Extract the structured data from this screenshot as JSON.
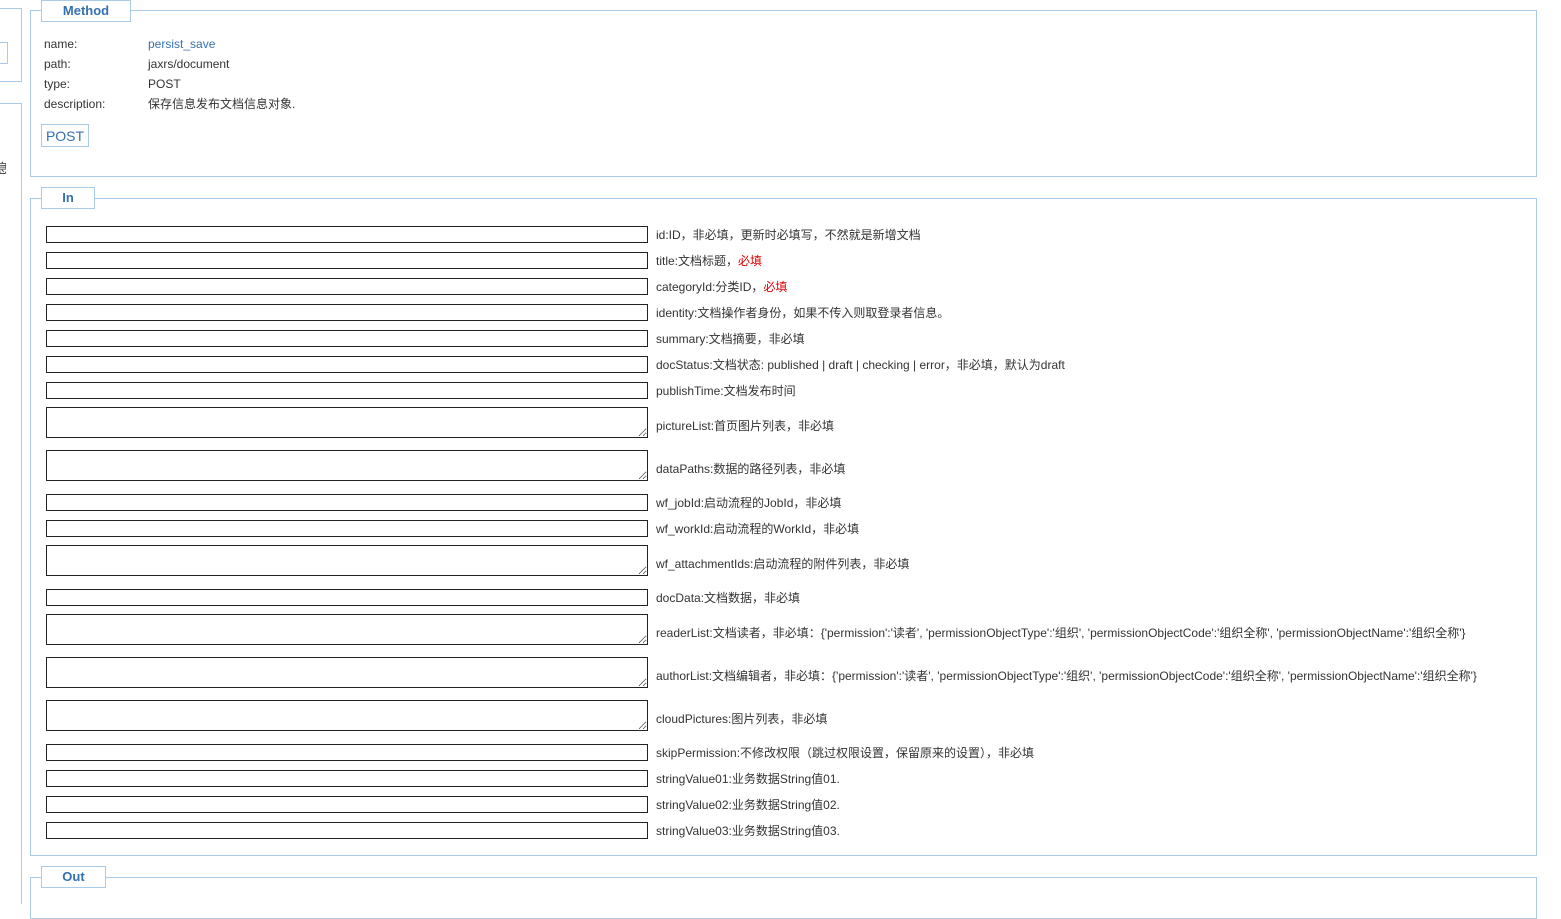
{
  "method": {
    "legend": "Method",
    "rows": [
      {
        "key": "name:",
        "value": "persist_save"
      },
      {
        "key": "path:",
        "value": "jaxrs/document"
      },
      {
        "key": "type:",
        "value": "POST"
      },
      {
        "key": "description:",
        "value": "保存信息发布文档信息对象."
      }
    ],
    "post_button": "POST"
  },
  "in": {
    "legend": "In",
    "params": [
      {
        "label": "id:ID，非必填，更新时必填写，不然就是新增文档"
      },
      {
        "label": "title:文档标题，",
        "required": "必填"
      },
      {
        "label": "categoryId:分类ID，",
        "required": "必填"
      },
      {
        "label": "identity:文档操作者身份，如果不传入则取登录者信息。"
      },
      {
        "label": "summary:文档摘要，非必填"
      },
      {
        "label": "docStatus:文档状态: published | draft | checking | error，非必填，默认为draft"
      },
      {
        "label": "publishTime:文档发布时间"
      },
      {
        "label": "pictureList:首页图片列表，非必填"
      },
      {
        "label": "dataPaths:数据的路径列表，非必填"
      },
      {
        "label": "wf_jobId:启动流程的JobId，非必填"
      },
      {
        "label": "wf_workId:启动流程的WorkId，非必填"
      },
      {
        "label": "wf_attachmentIds:启动流程的附件列表，非必填"
      },
      {
        "label": "docData:文档数据，非必填"
      },
      {
        "label": "readerList:文档读者，非必填：{'permission':'读者', 'permissionObjectType':'组织', 'permissionObjectCode':'组织全称', 'permissionObjectName':'组织全称'}"
      },
      {
        "label": "authorList:文档编辑者，非必填：{'permission':'读者', 'permissionObjectType':'组织', 'permissionObjectCode':'组织全称', 'permissionObjectName':'组织全称'}"
      },
      {
        "label": "cloudPictures:图片列表，非必填"
      },
      {
        "label": "skipPermission:不修改权限（跳过权限设置，保留原来的设置），非必填"
      },
      {
        "label": "stringValue01:业务数据String值01."
      },
      {
        "label": "stringValue02:业务数据String值02."
      },
      {
        "label": "stringValue03:业务数据String值03."
      }
    ]
  },
  "out": {
    "legend": "Out"
  },
  "sidebar": {
    "partial_text": "息"
  },
  "colors": {
    "accent": "#3571b1",
    "border": "#a9cbe8",
    "required": "#e00000"
  }
}
